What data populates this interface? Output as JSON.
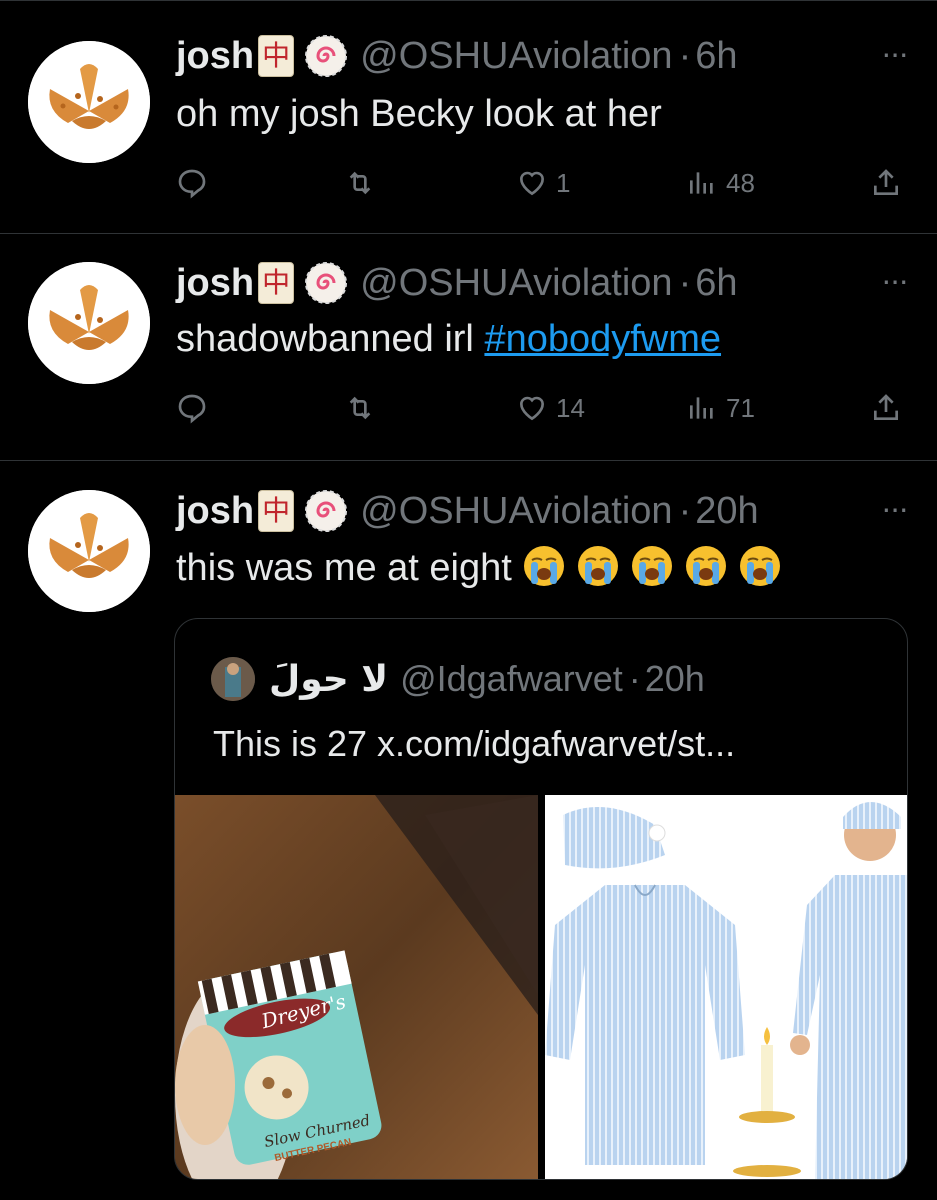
{
  "tweets": [
    {
      "name": "josh",
      "badge_char": "中",
      "handle": "@OSHUAviolation",
      "sep": "·",
      "time": "6h",
      "text": "oh my josh Becky look at her",
      "likes": "1",
      "views": "48"
    },
    {
      "name": "josh",
      "badge_char": "中",
      "handle": "@OSHUAviolation",
      "sep": "·",
      "time": "6h",
      "text": "shadowbanned irl ",
      "hashtag": "#nobodyfwme",
      "likes": "14",
      "views": "71"
    },
    {
      "name": "josh",
      "badge_char": "中",
      "handle": "@OSHUAviolation",
      "sep": "·",
      "time": "20h",
      "text": "this was me at eight",
      "emoji_count": 5,
      "quote": {
        "name": "لا حولَ",
        "handle": "@Idgafwarvet",
        "sep": "·",
        "time": "20h",
        "text": "This is 27 x.com/idgafwarvet/st...",
        "image_left_text": "Dreyer's",
        "image_left_sub": "Slow Churned",
        "image_left_flavor": "BUTTER PECAN"
      }
    }
  ],
  "ui": {
    "more_label": "···"
  },
  "colors": {
    "background": "#000000",
    "text": "#e7e9ea",
    "muted": "#71767b",
    "link": "#1d9bf0",
    "border": "#2f3336"
  },
  "icons": [
    "reply-icon",
    "retweet-icon",
    "like-icon",
    "views-icon",
    "share-icon",
    "more-icon"
  ]
}
